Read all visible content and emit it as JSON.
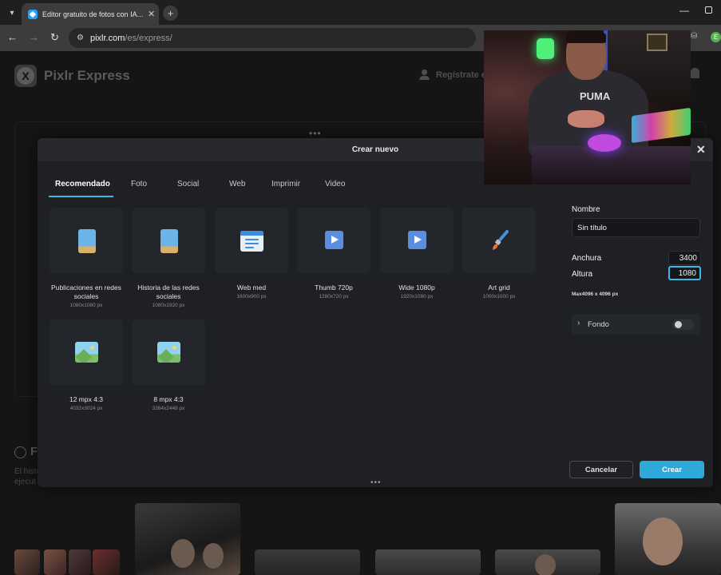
{
  "browser": {
    "tab_title": "Editor gratuito de fotos con IA...",
    "tab_close": "✕",
    "new_tab": "+",
    "url_domain": "pixlr.com",
    "url_path": "/es/express/",
    "profile_initial": "E"
  },
  "page": {
    "logo_letter": "X",
    "brand": "Pixlr Express",
    "register_label": "Regístrate e",
    "history_title_partial": "F",
    "history_desc_line1": "El histo",
    "history_desc_line2": "ejecut"
  },
  "modal": {
    "title": "Crear nuevo",
    "close": "✕",
    "tabs": [
      "Recomendado",
      "Foto",
      "Social",
      "Web",
      "Imprimir",
      "Video"
    ],
    "active_tab": "Recomendado",
    "presets": [
      {
        "label": "Publicaciones en redes sociales",
        "size": "1080x1080 px",
        "icon": "phone-icon"
      },
      {
        "label": "Historia de las redes sociales",
        "size": "1080x1920 px",
        "icon": "phone-icon"
      },
      {
        "label": "Web med",
        "size": "1600x900 px",
        "icon": "web-page-icon"
      },
      {
        "label": "Thumb 720p",
        "size": "1280x720 px",
        "icon": "play-icon"
      },
      {
        "label": "Wide 1080p",
        "size": "1920x1080 px",
        "icon": "play-icon"
      },
      {
        "label": "Art grid",
        "size": "1000x1000 px",
        "icon": "paintbrush-icon"
      },
      {
        "label": "12 mpx 4:3",
        "size": "4032x3024 px",
        "icon": "image-icon"
      },
      {
        "label": "8 mpx 4:3",
        "size": "3264x2448 px",
        "icon": "image-icon"
      }
    ],
    "name_label": "Nombre",
    "name_value": "Sin título",
    "width_label": "Anchura",
    "width_value": "3400",
    "height_label": "Altura",
    "height_value": "1080",
    "max_note": "Max4096 x 4096 px",
    "background_label": "Fondo",
    "background_enabled": false,
    "cancel_label": "Cancelar",
    "create_label": "Crear",
    "accent_color": "#2ea9d9"
  },
  "webcam": {
    "shirt_text": "PUMA"
  }
}
